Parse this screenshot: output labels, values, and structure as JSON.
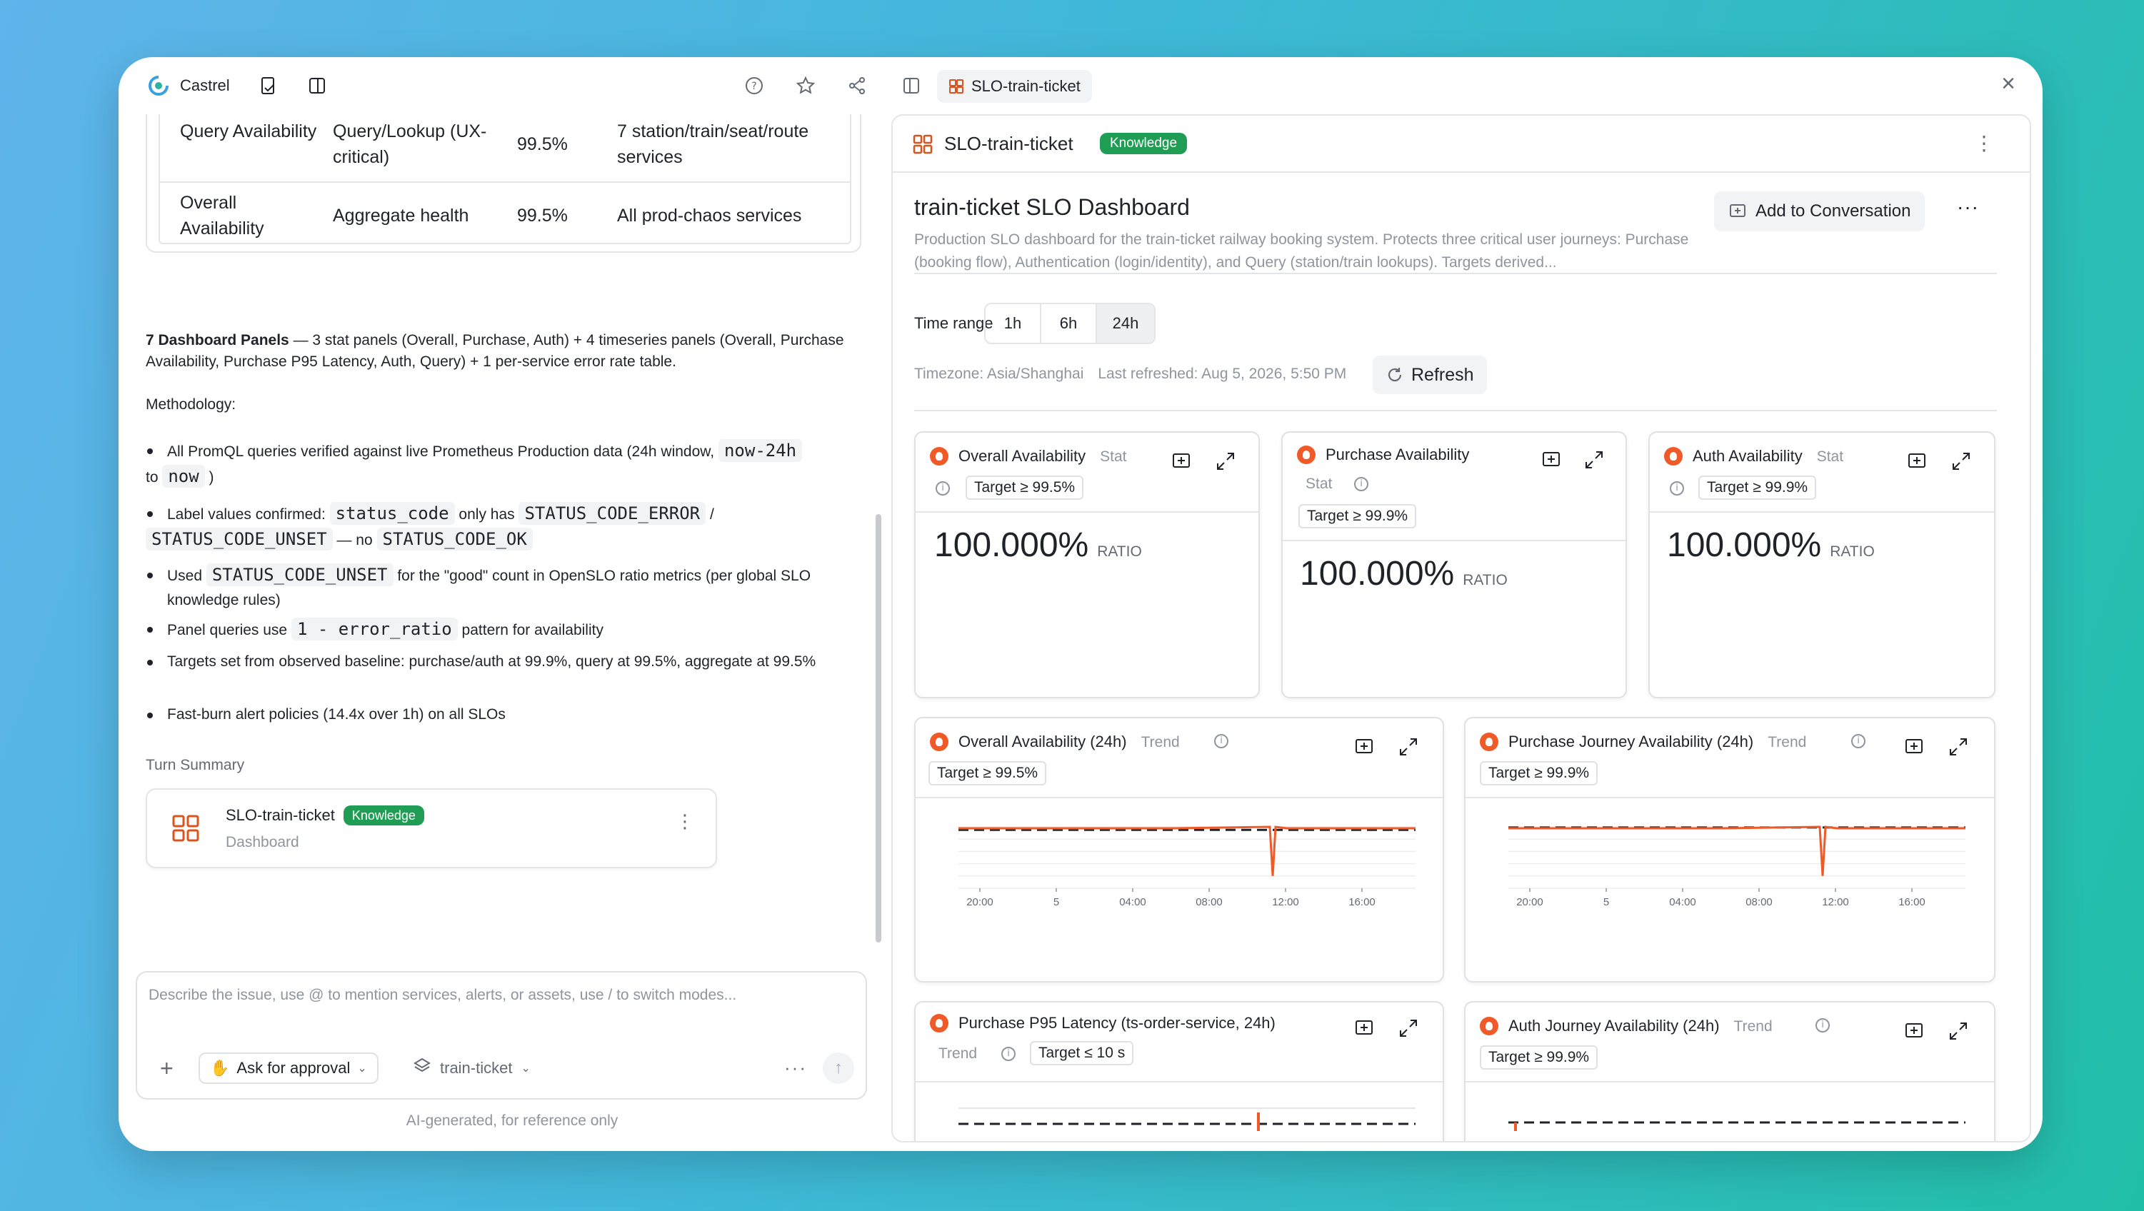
{
  "app": {
    "name": "Castrel"
  },
  "slo_table": {
    "rows": [
      {
        "name": "Query Availability",
        "scope": "Query/Lookup (UX-critical)",
        "target": "99.5%",
        "services": "7 station/train/seat/route services"
      },
      {
        "name": "Overall Availability",
        "scope": "Aggregate health",
        "target": "99.5%",
        "services": "All prod-chaos services"
      }
    ]
  },
  "content": {
    "panels_bold": "7 Dashboard Panels",
    "panels_text": " — 3 stat panels (Overall, Purchase, Auth) + 4 timeseries panels (Overall, Purchase Availability, Purchase P95 Latency, Auth, Query) + 1 per-service error rate table.",
    "methodology_label": "Methodology:",
    "b1_a": "All PromQL queries verified against live Prometheus Production data (24h window, ",
    "b1_code1": "now-24h",
    "b1_b": " to ",
    "b1_code2": "now",
    "b1_c": " )",
    "b2_a": "Label values confirmed: ",
    "b2_code1": "status_code",
    "b2_b": " only has ",
    "b2_code2": "STATUS_CODE_ERROR",
    "b2_c": " / ",
    "b2_code3": "STATUS_CODE_UNSET",
    "b2_d": " — no ",
    "b2_code4": "STATUS_CODE_OK",
    "b3_a": "Used ",
    "b3_code": "STATUS_CODE_UNSET",
    "b3_b": " for the \"good\" count in OpenSLO ratio metrics (per global SLO knowledge rules)",
    "b4_a": "Panel queries use ",
    "b4_code": "1 - error_ratio",
    "b4_b": " pattern for availability",
    "b5": "Targets set from observed baseline: purchase/auth at 99.9%, query at 99.5%, aggregate at 99.5%",
    "b6": "Fast-burn alert policies (14.4x over 1h) on all SLOs",
    "turn_summary": "Turn Summary"
  },
  "summary_card": {
    "title": "SLO-train-ticket",
    "badge": "Knowledge",
    "subtitle": "Dashboard"
  },
  "composer": {
    "placeholder": "Describe the issue, use @ to mention services, alerts, or assets, use / to switch modes...",
    "mode": "Ask for approval",
    "project": "train-ticket",
    "disclaimer": "AI-generated, for reference only"
  },
  "right": {
    "tab_label": "SLO-train-ticket",
    "header_title": "SLO-train-ticket",
    "header_badge": "Knowledge",
    "dashboard_title": "train-ticket SLO Dashboard",
    "description": "Production SLO dashboard for the train-ticket railway booking system. Protects three critical user journeys: Purchase (booking flow), Authentication (login/identity), and Query (station/train lookups). Targets derived...",
    "add_button": "Add to Conversation",
    "time_range_label": "Time range",
    "time_ranges": [
      "1h",
      "6h",
      "24h"
    ],
    "selected_range": "24h",
    "timezone": "Timezone: Asia/Shanghai",
    "last_refreshed": "Last refreshed: Aug 5, 2026, 5:50 PM",
    "refresh": "Refresh"
  },
  "panels": {
    "stat1": {
      "title": "Overall Availability",
      "type": "Stat",
      "target": "Target ≥ 99.5%",
      "value": "100.000%",
      "unit": "RATIO"
    },
    "stat2": {
      "title": "Purchase Availability",
      "type": "Stat",
      "target": "Target ≥ 99.9%",
      "value": "100.000%",
      "unit": "RATIO"
    },
    "stat3": {
      "title": "Auth Availability",
      "type": "Stat",
      "target": "Target ≥ 99.9%",
      "value": "100.000%",
      "unit": "RATIO"
    },
    "ts1": {
      "title": "Overall Availability (24h)",
      "type": "Trend",
      "target": "Target ≥ 99.5%"
    },
    "ts2": {
      "title": "Purchase Journey Availability (24h)",
      "type": "Trend",
      "target": "Target ≥ 99.9%"
    },
    "ts3": {
      "title": "Purchase P95 Latency (ts-order-service, 24h)",
      "type": "Trend",
      "target": "Target ≤ 10 s"
    },
    "ts4": {
      "title": "Auth Journey Availability (24h)",
      "type": "Trend",
      "target": "Target ≥ 99.9%"
    }
  },
  "chart_data": [
    {
      "type": "line",
      "title": "Overall Availability (24h)",
      "x": [
        "20:00",
        "5",
        "04:00",
        "08:00",
        "12:00",
        "16:00"
      ],
      "series": [
        {
          "values": [
            1,
            1,
            1,
            1,
            0.92,
            1,
            1
          ]
        }
      ],
      "threshold": 0.995
    },
    {
      "type": "line",
      "title": "Purchase Journey Availability (24h)",
      "x": [
        "20:00",
        "5",
        "04:00",
        "08:00",
        "12:00",
        "16:00"
      ],
      "series": [
        {
          "values": [
            1,
            1,
            1,
            1,
            0.92,
            1,
            1
          ]
        }
      ],
      "threshold": 0.999
    }
  ],
  "colors": {
    "accent": "#f05a28",
    "badge": "#1f9d55",
    "threshold": "#1f2329"
  }
}
